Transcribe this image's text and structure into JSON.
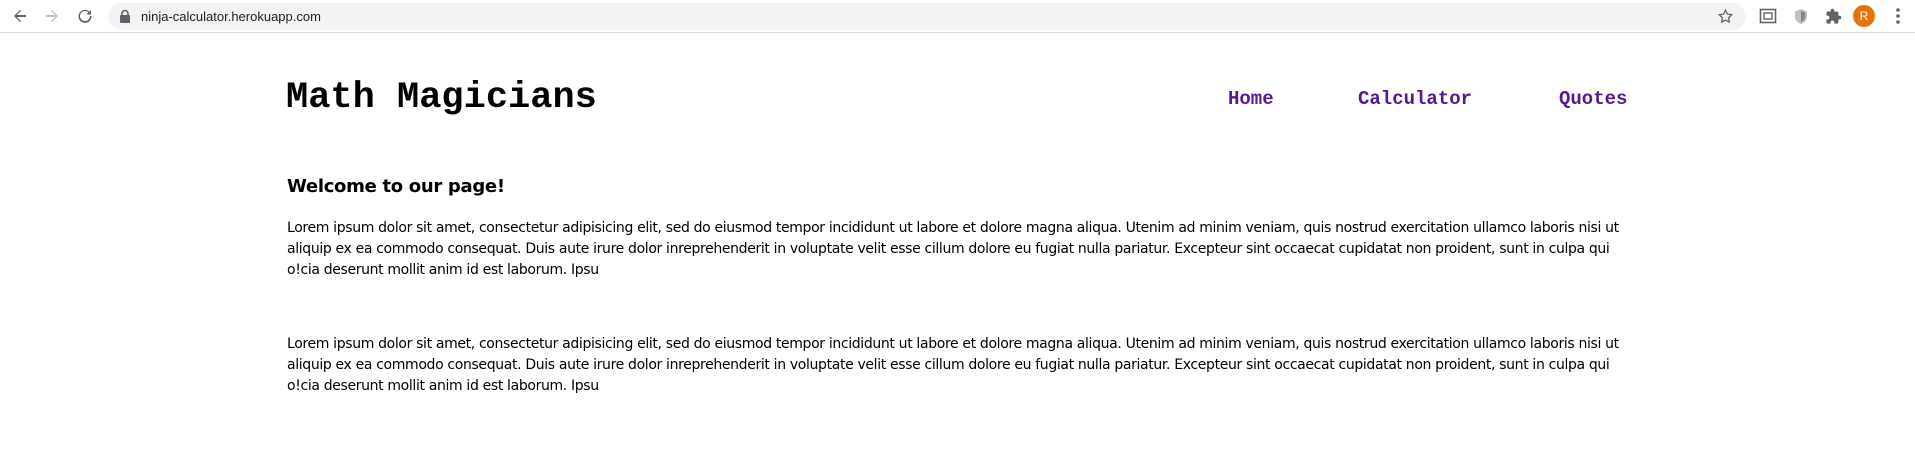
{
  "browser": {
    "url": "ninja-calculator.herokuapp.com",
    "profile_initial": "R",
    "icons": [
      "back-arrow-icon",
      "forward-arrow-icon",
      "reload-icon",
      "lock-icon",
      "star-icon",
      "cast-icon",
      "shield-extension-icon",
      "puzzle-extension-icon",
      "kebab-menu-icon"
    ]
  },
  "site": {
    "title": "Math Magicians",
    "nav": [
      {
        "label": "Home"
      },
      {
        "label": "Calculator"
      },
      {
        "label": "Quotes"
      }
    ]
  },
  "main": {
    "heading": "Welcome to our page!",
    "paragraphs": [
      "Lorem ipsum dolor sit amet, consectetur adipisicing elit, sed do eiusmod tempor incididunt ut labore et dolore magna aliqua. Utenim ad minim veniam, quis nostrud exercitation ullamco laboris nisi ut aliquip ex ea commodo consequat. Duis aute irure dolor inreprehenderit in voluptate velit esse cillum dolore eu fugiat nulla pariatur. Excepteur sint occaecat cupidatat non proident, sunt in culpa qui o!cia deserunt mollit anim id est laborum. Ipsu",
      "Lorem ipsum dolor sit amet, consectetur adipisicing elit, sed do eiusmod tempor incididunt ut labore et dolore magna aliqua. Utenim ad minim veniam, quis nostrud exercitation ullamco laboris nisi ut aliquip ex ea commodo consequat. Duis aute irure dolor inreprehenderit in voluptate velit esse cillum dolore eu fugiat nulla pariatur. Excepteur sint occaecat cupidatat non proident, sunt in culpa qui o!cia deserunt mollit anim id est laborum. Ipsu"
    ]
  },
  "colors": {
    "nav_link": "#551a8b",
    "avatar": "#e8710a",
    "omnibox": "#f1f3f4"
  }
}
